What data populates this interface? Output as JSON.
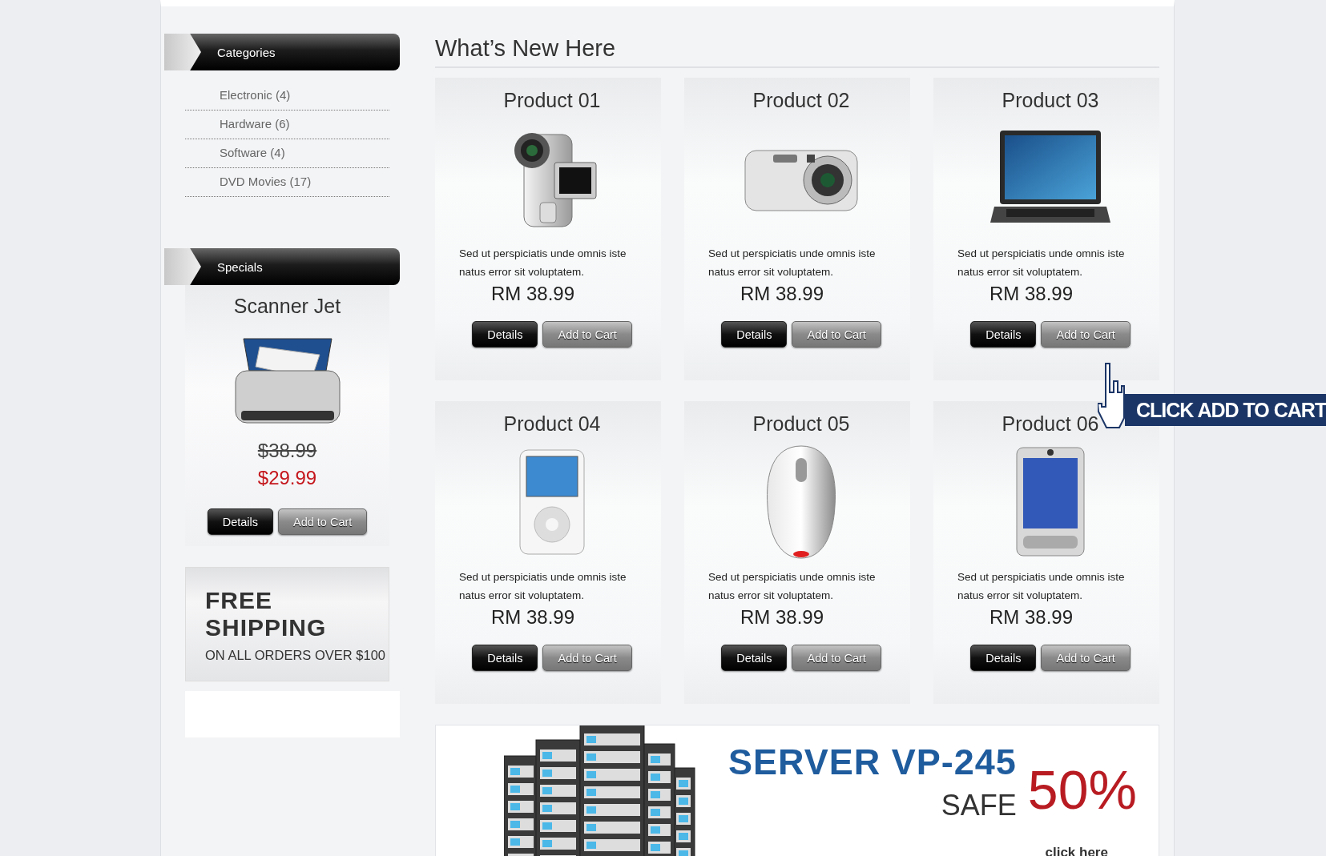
{
  "sidebar": {
    "categories": {
      "title": "Categories",
      "items": [
        {
          "label": "Electronic (4)"
        },
        {
          "label": "Hardware (6)"
        },
        {
          "label": "Software (4)"
        },
        {
          "label": "DVD Movies (17)"
        }
      ]
    },
    "specials": {
      "title": "Specials",
      "product": {
        "name": "Scanner Jet",
        "kind": "scanner",
        "old_price": "$38.99",
        "price": "$29.99",
        "buttons": [
          "Details",
          "Add to Cart"
        ]
      }
    },
    "promo": {
      "headline": "FREE SHIPPING",
      "subline": "ON ALL ORDERS OVER $100"
    }
  },
  "main": {
    "heading": "What’s New Here",
    "products": [
      {
        "name": "Product 01",
        "kind": "camcorder",
        "description": "Sed ut perspiciatis unde omnis iste natus error sit voluptatem.",
        "price": "RM 38.99",
        "buttons": [
          "Details",
          "Add to Cart"
        ]
      },
      {
        "name": "Product 02",
        "kind": "camera",
        "description": "Sed ut perspiciatis unde omnis iste natus error sit voluptatem.",
        "price": "RM 38.99",
        "buttons": [
          "Details",
          "Add to Cart"
        ]
      },
      {
        "name": "Product 03",
        "kind": "laptop",
        "description": "Sed ut perspiciatis unde omnis iste natus error sit voluptatem.",
        "price": "RM 38.99",
        "buttons": [
          "Details",
          "Add to Cart"
        ]
      },
      {
        "name": "Product 04",
        "kind": "player",
        "description": "Sed ut perspiciatis unde omnis iste natus error sit voluptatem.",
        "price": "RM 38.99",
        "buttons": [
          "Details",
          "Add to Cart"
        ]
      },
      {
        "name": "Product 05",
        "kind": "mouse",
        "description": "Sed ut perspiciatis unde omnis iste natus error sit voluptatem.",
        "price": "RM 38.99",
        "buttons": [
          "Details",
          "Add to Cart"
        ]
      },
      {
        "name": "Product 06",
        "kind": "handheld",
        "description": "Sed ut perspiciatis unde omnis iste natus error sit voluptatem.",
        "price": "RM 38.99",
        "buttons": [
          "Details",
          "Add to Cart"
        ]
      }
    ]
  },
  "banner": {
    "title": "SERVER VP-245",
    "subtitle": "SAFE",
    "discount": "50%",
    "link": "click here"
  },
  "callout": {
    "text": "CLICK ADD TO CART"
  }
}
